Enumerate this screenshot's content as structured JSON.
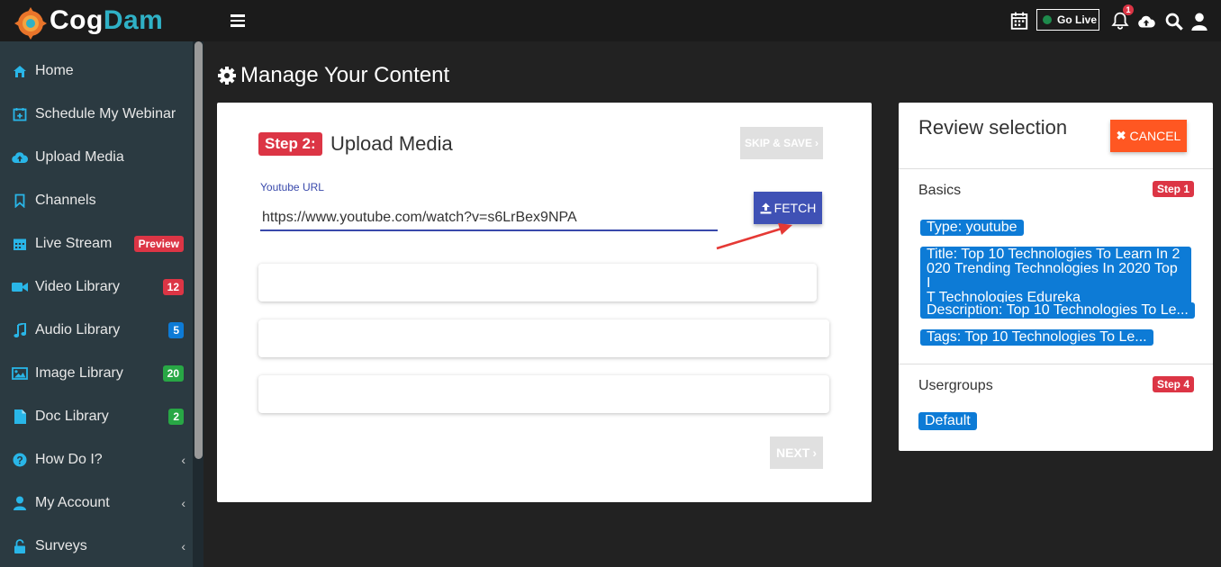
{
  "brand": {
    "name_part1": "Cog",
    "name_part2": "Dam"
  },
  "sidebar": {
    "items": [
      {
        "label": "Home",
        "icon": "home-icon"
      },
      {
        "label": "Schedule My Webinar",
        "icon": "calendar-plus-icon"
      },
      {
        "label": "Upload Media",
        "icon": "cloud-upload-icon"
      },
      {
        "label": "Channels",
        "icon": "bookmark-icon"
      },
      {
        "label": "Live Stream",
        "icon": "calendar-icon",
        "badge": "Preview"
      },
      {
        "label": "Video Library",
        "icon": "video-camera-icon",
        "badge": "12"
      },
      {
        "label": "Audio Library",
        "icon": "music-note-icon",
        "badge": "5"
      },
      {
        "label": "Image Library",
        "icon": "image-icon",
        "badge": "20"
      },
      {
        "label": "Doc Library",
        "icon": "document-icon",
        "badge": "2"
      },
      {
        "label": "How Do I?",
        "icon": "question-circle-icon"
      },
      {
        "label": "My Account",
        "icon": "user-icon"
      },
      {
        "label": "Surveys",
        "icon": "lock-open-icon"
      }
    ]
  },
  "topbar": {
    "go_live_label": "Go Live",
    "notification_count": "1"
  },
  "page": {
    "title": "Manage Your Content"
  },
  "upload": {
    "step_badge": "Step 2:",
    "step_title": "Upload Media",
    "skip_label": "SKIP & SAVE",
    "url_label": "Youtube URL",
    "url_value": "https://www.youtube.com/watch?v=s6LrBex9NPA",
    "fetch_label": "FETCH",
    "next_label": "NEXT"
  },
  "review": {
    "title": "Review selection",
    "cancel_label": "CANCEL",
    "basics_label": "Basics",
    "basics_step": "Step 1",
    "chips": [
      "Type: youtube",
      "Title: Top 10 Technologies To Learn In 2",
      "020 Trending Technologies In 2020 Top I",
      "T Technologies Edureka",
      "Description: Top 10 Technologies To Le...",
      "Tags: Top 10 Technologies To Le..."
    ],
    "usergroups_label": "Usergroups",
    "usergroups_step": "Step 4",
    "usergroup_value": "Default"
  },
  "colors": {
    "sidebar_bg": "#2b3a41",
    "topbar_bg": "#1b1b1b",
    "content_bg": "#222222",
    "accent_blue": "#3f51b5",
    "chip_blue": "#0d7bd6",
    "danger_red": "#dc3545",
    "cancel_orange": "#ff5722",
    "icon_cyan": "#29b6e8"
  }
}
